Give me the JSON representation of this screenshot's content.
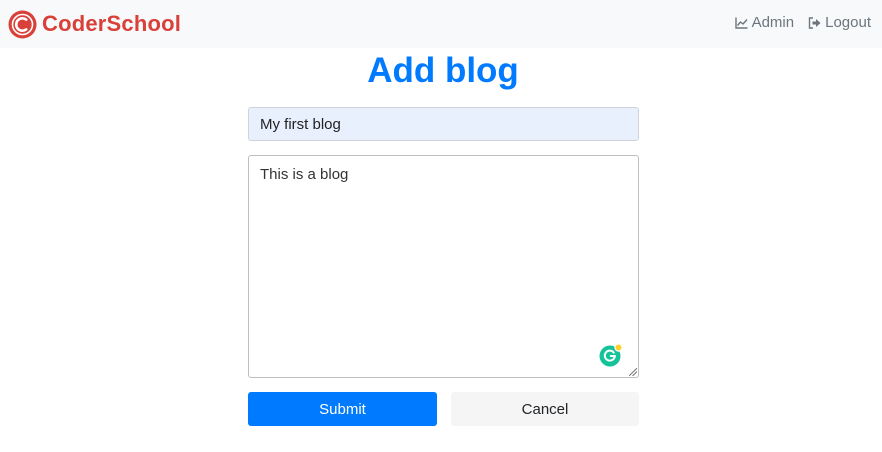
{
  "navbar": {
    "brand": "CoderSchool",
    "links": [
      {
        "label": "Admin",
        "icon": "chart-line-icon"
      },
      {
        "label": "Logout",
        "icon": "sign-out-icon"
      }
    ]
  },
  "page": {
    "title": "Add blog"
  },
  "form": {
    "title_value": "My first blog",
    "content_value": "This is a blog",
    "submit_label": "Submit",
    "cancel_label": "Cancel"
  },
  "colors": {
    "brand": "#d9403a",
    "accent": "#007bff",
    "grammarly": "#15c39a"
  }
}
